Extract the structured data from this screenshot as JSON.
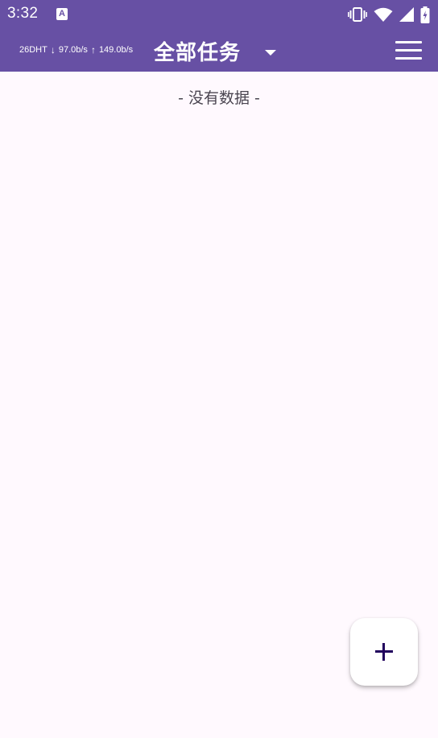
{
  "status_bar": {
    "time": "3:32",
    "notification_icon_letter": "A",
    "icons": [
      "vibrate-icon",
      "wifi-icon",
      "signal-icon",
      "battery-icon"
    ]
  },
  "app_bar": {
    "speed": {
      "dht": "26DHT",
      "download": "97.0b/s",
      "upload": "149.0b/s"
    },
    "title": "全部任务",
    "icons": [
      "dropdown-icon",
      "menu-icon"
    ]
  },
  "main": {
    "empty_text": "- 没有数据 -"
  },
  "fab": {
    "icon": "add-icon"
  },
  "colors": {
    "primary": "#6750A4",
    "background": "#FFF9FE",
    "fab_background": "#FFFFFF",
    "fab_icon": "#21005D"
  }
}
